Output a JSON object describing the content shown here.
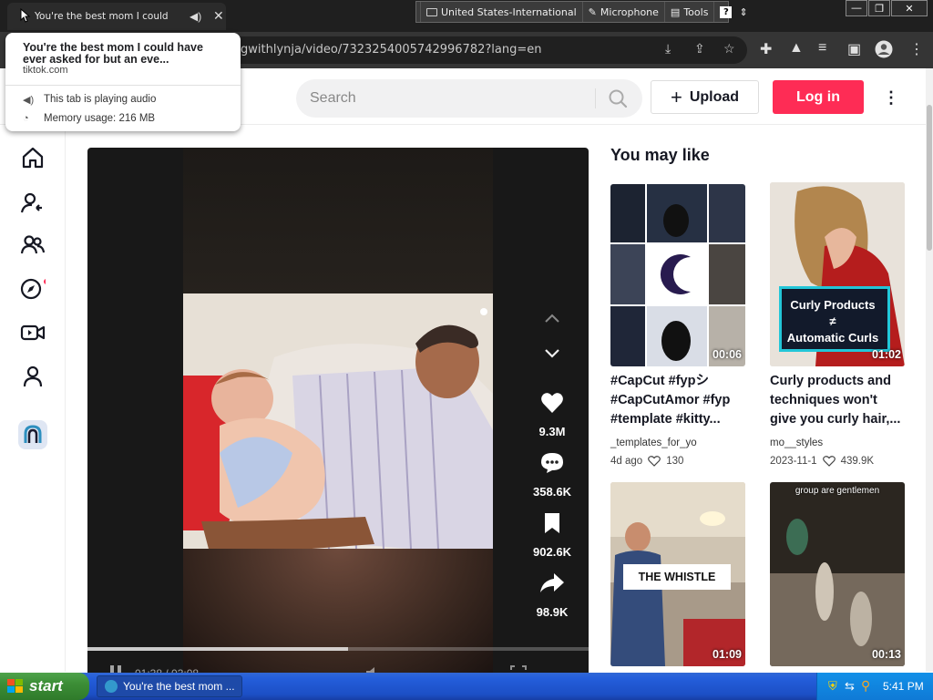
{
  "browser": {
    "tab_title": "You're the best mom I could ha",
    "url": "gwithlynja/video/7323254005742996782?lang=en",
    "hovercard": {
      "title": "You're the best mom I could have ever asked for but an eve...",
      "domain": "tiktok.com",
      "audio_text": "This tab is playing audio",
      "memory_text": "Memory usage: 216 MB"
    },
    "language_bar": {
      "language": "United States-International",
      "microphone": "Microphone",
      "tools": "Tools",
      "help": "?"
    }
  },
  "header": {
    "search_placeholder": "Search",
    "upload_label": "Upload",
    "login_label": "Log in"
  },
  "video": {
    "progress": 0.52,
    "timecode": "01:38 / 03:08",
    "likes": "9.3M",
    "comments": "358.6K",
    "saves": "902.6K",
    "shares": "98.9K"
  },
  "you_may_like": {
    "title": "You may like",
    "cards": [
      {
        "duration": "00:06",
        "caption": "#CapCut #fypシ #CapCutAmor #fyp #template #kitty...",
        "author": "_templates_for_yo",
        "date": "4d ago",
        "likes": "130"
      },
      {
        "duration": "01:02",
        "caption": "Curly products and techniques won't give you curly hair,...",
        "author": "mo__styles",
        "date": "2023-11-1",
        "likes": "439.9K",
        "overlay_line1": "Curly Products",
        "overlay_line2": "≠",
        "overlay_line3": "Automatic Curls"
      },
      {
        "duration": "01:09",
        "overlay": "THE WHISTLE"
      },
      {
        "duration": "00:13",
        "overlay": "group are gentlemen"
      }
    ]
  },
  "taskbar": {
    "start_label": "start",
    "task_label": "You're the best mom ...",
    "clock": "5:41 PM"
  },
  "colors": {
    "brand_red": "#fe2c55",
    "xp_blue": "#245edb",
    "xp_green": "#3c8e36"
  }
}
